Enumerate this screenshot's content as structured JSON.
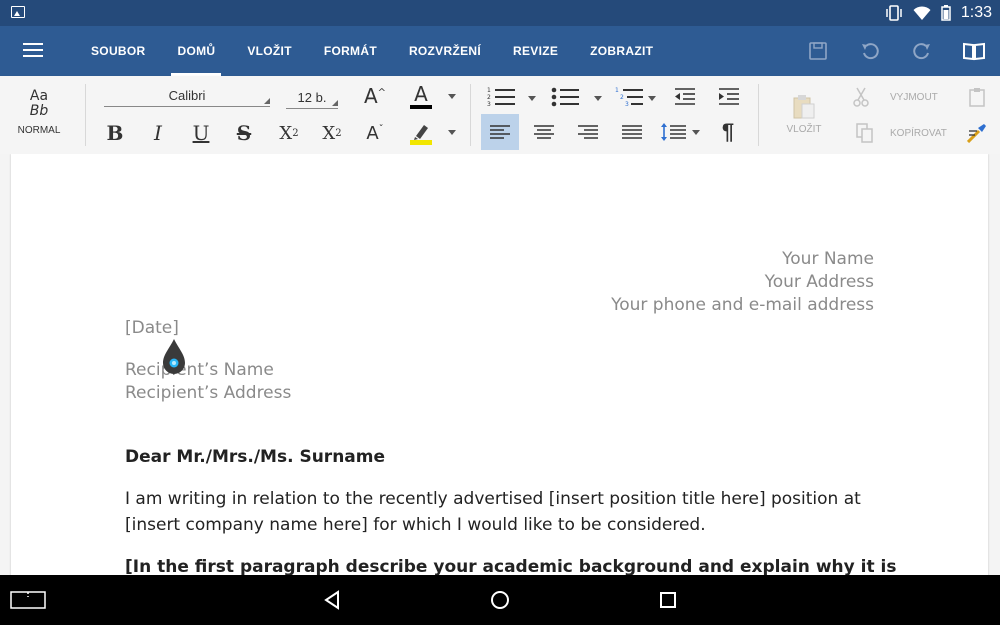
{
  "status": {
    "time": "1:33"
  },
  "menu": {
    "tabs": [
      "SOUBOR",
      "DOMŮ",
      "VLOŽIT",
      "FORMÁT",
      "ROZVRŽENÍ",
      "REVIZE",
      "ZOBRAZIT"
    ],
    "active": "DOMŮ"
  },
  "ribbon": {
    "style_preview_top": "Aa",
    "style_preview_bottom": "Bb",
    "style_name": "NORMAL",
    "font_name": "Calibri",
    "font_size": "12 b.",
    "paste_label": "VLOŽIT",
    "cut_label": "VYJMOUT",
    "copy_label": "KOPÍROVAT",
    "font_color": "#000000",
    "highlight_color": "#f2e600",
    "accent": "#2e5b93"
  },
  "document": {
    "sender_name": "Your Name",
    "sender_address": "Your Address",
    "sender_contact": "Your phone and e-mail address",
    "date": "[Date]",
    "recipient_name": "Recipient’s Name",
    "recipient_address": "Recipient’s Address",
    "greeting": "Dear Mr./Mrs./Ms. Surname",
    "para1_line1": "I am writing in relation to the recently advertised [insert position title here] position at",
    "para1_line2": "[insert company name here] for which I would like to be considered.",
    "para2_line1": "[In the first paragraph describe your academic background and explain why it is"
  }
}
